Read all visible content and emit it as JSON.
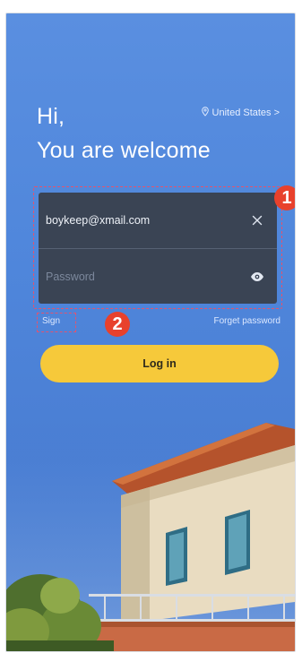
{
  "header": {
    "greeting_line1": "Hi,",
    "greeting_line2": "You are welcome",
    "region_label": "United States",
    "region_chevron": ">"
  },
  "form": {
    "email_value": "boykeep@xmail.com",
    "password_placeholder": "Password"
  },
  "links": {
    "sign": "Sign",
    "forget_password": "Forget password"
  },
  "actions": {
    "login_label": "Log in"
  },
  "annotations": {
    "badge_1": "1",
    "badge_2": "2"
  },
  "icons": {
    "location": "location-pin-icon",
    "clear": "close-icon",
    "reveal": "eye-icon"
  },
  "colors": {
    "background": "#4f86db",
    "input_card": "#3a4454",
    "login_button": "#f6c93a",
    "annotation": "#e8412c"
  }
}
